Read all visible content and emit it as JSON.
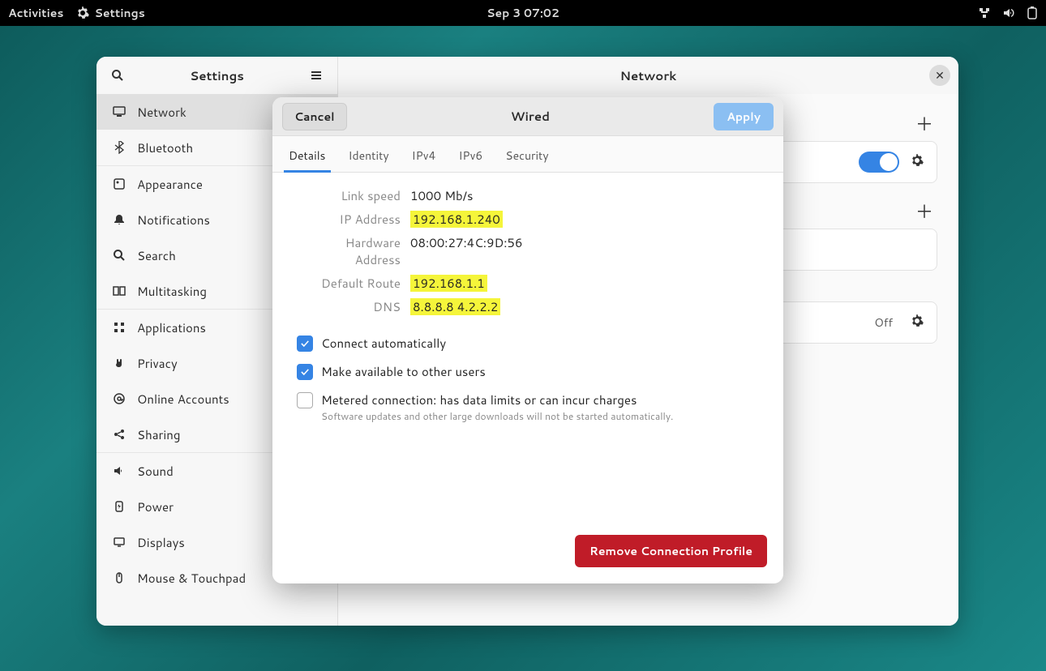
{
  "topbar": {
    "activities": "Activities",
    "app_name": "Settings",
    "datetime": "Sep 3  07:02"
  },
  "sidebar": {
    "title": "Settings",
    "items": [
      {
        "label": "Network"
      },
      {
        "label": "Bluetooth"
      },
      {
        "label": "Appearance"
      },
      {
        "label": "Notifications"
      },
      {
        "label": "Search"
      },
      {
        "label": "Multitasking"
      },
      {
        "label": "Applications"
      },
      {
        "label": "Privacy"
      },
      {
        "label": "Online Accounts"
      },
      {
        "label": "Sharing"
      },
      {
        "label": "Sound"
      },
      {
        "label": "Power"
      },
      {
        "label": "Displays"
      },
      {
        "label": "Mouse & Touchpad"
      }
    ]
  },
  "main": {
    "title": "Network",
    "proxy_off": "Off"
  },
  "modal": {
    "cancel": "Cancel",
    "title": "Wired",
    "apply": "Apply",
    "tabs": [
      "Details",
      "Identity",
      "IPv4",
      "IPv6",
      "Security"
    ],
    "details": {
      "link_speed_label": "Link speed",
      "link_speed_value": "1000 Mb/s",
      "ip_label": "IP Address",
      "ip_value": "192.168.1.240",
      "hw_label": "Hardware Address",
      "hw_value": "08:00:27:4C:9D:56",
      "route_label": "Default Route",
      "route_value": "192.168.1.1",
      "dns_label": "DNS",
      "dns_value": "8.8.8.8 4.2.2.2"
    },
    "checks": {
      "auto": "Connect automatically",
      "share": "Make available to other users",
      "metered": "Metered connection: has data limits or can incur charges",
      "metered_sub": "Software updates and other large downloads will not be started automatically."
    },
    "remove": "Remove Connection Profile"
  }
}
